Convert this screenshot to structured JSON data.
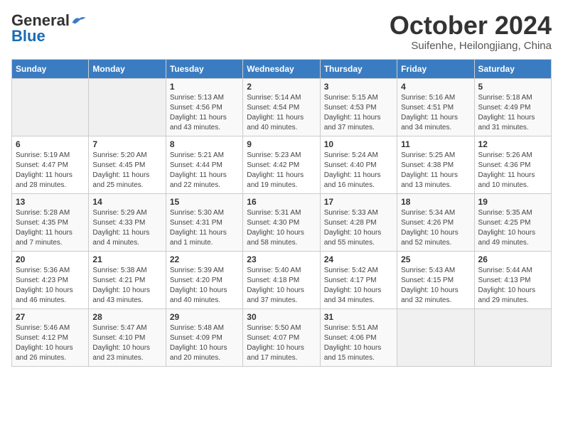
{
  "logo": {
    "general": "General",
    "blue": "Blue"
  },
  "header": {
    "month": "October 2024",
    "location": "Suifenhe, Heilongjiang, China"
  },
  "weekdays": [
    "Sunday",
    "Monday",
    "Tuesday",
    "Wednesday",
    "Thursday",
    "Friday",
    "Saturday"
  ],
  "weeks": [
    [
      {
        "day": "",
        "info": ""
      },
      {
        "day": "",
        "info": ""
      },
      {
        "day": "1",
        "info": "Sunrise: 5:13 AM\nSunset: 4:56 PM\nDaylight: 11 hours and 43 minutes."
      },
      {
        "day": "2",
        "info": "Sunrise: 5:14 AM\nSunset: 4:54 PM\nDaylight: 11 hours and 40 minutes."
      },
      {
        "day": "3",
        "info": "Sunrise: 5:15 AM\nSunset: 4:53 PM\nDaylight: 11 hours and 37 minutes."
      },
      {
        "day": "4",
        "info": "Sunrise: 5:16 AM\nSunset: 4:51 PM\nDaylight: 11 hours and 34 minutes."
      },
      {
        "day": "5",
        "info": "Sunrise: 5:18 AM\nSunset: 4:49 PM\nDaylight: 11 hours and 31 minutes."
      }
    ],
    [
      {
        "day": "6",
        "info": "Sunrise: 5:19 AM\nSunset: 4:47 PM\nDaylight: 11 hours and 28 minutes."
      },
      {
        "day": "7",
        "info": "Sunrise: 5:20 AM\nSunset: 4:45 PM\nDaylight: 11 hours and 25 minutes."
      },
      {
        "day": "8",
        "info": "Sunrise: 5:21 AM\nSunset: 4:44 PM\nDaylight: 11 hours and 22 minutes."
      },
      {
        "day": "9",
        "info": "Sunrise: 5:23 AM\nSunset: 4:42 PM\nDaylight: 11 hours and 19 minutes."
      },
      {
        "day": "10",
        "info": "Sunrise: 5:24 AM\nSunset: 4:40 PM\nDaylight: 11 hours and 16 minutes."
      },
      {
        "day": "11",
        "info": "Sunrise: 5:25 AM\nSunset: 4:38 PM\nDaylight: 11 hours and 13 minutes."
      },
      {
        "day": "12",
        "info": "Sunrise: 5:26 AM\nSunset: 4:36 PM\nDaylight: 11 hours and 10 minutes."
      }
    ],
    [
      {
        "day": "13",
        "info": "Sunrise: 5:28 AM\nSunset: 4:35 PM\nDaylight: 11 hours and 7 minutes."
      },
      {
        "day": "14",
        "info": "Sunrise: 5:29 AM\nSunset: 4:33 PM\nDaylight: 11 hours and 4 minutes."
      },
      {
        "day": "15",
        "info": "Sunrise: 5:30 AM\nSunset: 4:31 PM\nDaylight: 11 hours and 1 minute."
      },
      {
        "day": "16",
        "info": "Sunrise: 5:31 AM\nSunset: 4:30 PM\nDaylight: 10 hours and 58 minutes."
      },
      {
        "day": "17",
        "info": "Sunrise: 5:33 AM\nSunset: 4:28 PM\nDaylight: 10 hours and 55 minutes."
      },
      {
        "day": "18",
        "info": "Sunrise: 5:34 AM\nSunset: 4:26 PM\nDaylight: 10 hours and 52 minutes."
      },
      {
        "day": "19",
        "info": "Sunrise: 5:35 AM\nSunset: 4:25 PM\nDaylight: 10 hours and 49 minutes."
      }
    ],
    [
      {
        "day": "20",
        "info": "Sunrise: 5:36 AM\nSunset: 4:23 PM\nDaylight: 10 hours and 46 minutes."
      },
      {
        "day": "21",
        "info": "Sunrise: 5:38 AM\nSunset: 4:21 PM\nDaylight: 10 hours and 43 minutes."
      },
      {
        "day": "22",
        "info": "Sunrise: 5:39 AM\nSunset: 4:20 PM\nDaylight: 10 hours and 40 minutes."
      },
      {
        "day": "23",
        "info": "Sunrise: 5:40 AM\nSunset: 4:18 PM\nDaylight: 10 hours and 37 minutes."
      },
      {
        "day": "24",
        "info": "Sunrise: 5:42 AM\nSunset: 4:17 PM\nDaylight: 10 hours and 34 minutes."
      },
      {
        "day": "25",
        "info": "Sunrise: 5:43 AM\nSunset: 4:15 PM\nDaylight: 10 hours and 32 minutes."
      },
      {
        "day": "26",
        "info": "Sunrise: 5:44 AM\nSunset: 4:13 PM\nDaylight: 10 hours and 29 minutes."
      }
    ],
    [
      {
        "day": "27",
        "info": "Sunrise: 5:46 AM\nSunset: 4:12 PM\nDaylight: 10 hours and 26 minutes."
      },
      {
        "day": "28",
        "info": "Sunrise: 5:47 AM\nSunset: 4:10 PM\nDaylight: 10 hours and 23 minutes."
      },
      {
        "day": "29",
        "info": "Sunrise: 5:48 AM\nSunset: 4:09 PM\nDaylight: 10 hours and 20 minutes."
      },
      {
        "day": "30",
        "info": "Sunrise: 5:50 AM\nSunset: 4:07 PM\nDaylight: 10 hours and 17 minutes."
      },
      {
        "day": "31",
        "info": "Sunrise: 5:51 AM\nSunset: 4:06 PM\nDaylight: 10 hours and 15 minutes."
      },
      {
        "day": "",
        "info": ""
      },
      {
        "day": "",
        "info": ""
      }
    ]
  ]
}
